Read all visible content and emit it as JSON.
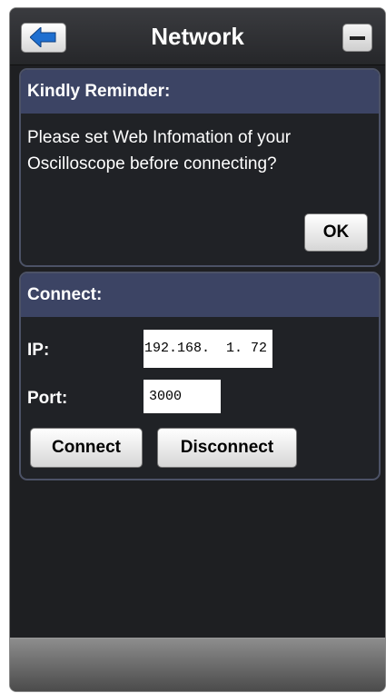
{
  "header": {
    "title": "Network",
    "back_icon": "arrow-left-icon",
    "minimize_icon": "minimize-icon"
  },
  "reminder": {
    "heading": "Kindly Reminder:",
    "message": "Please set Web Infomation of your Oscilloscope before connecting?",
    "ok_label": "OK"
  },
  "connect": {
    "heading": "Connect:",
    "ip_label": "IP:",
    "ip_value": "192.168.  1. 72",
    "port_label": "Port:",
    "port_value": "3000",
    "connect_label": "Connect",
    "disconnect_label": "Disconnect"
  },
  "colors": {
    "panel_header": "#3c4464",
    "background": "#1e1f22",
    "accent_arrow": "#1e6fd0"
  }
}
